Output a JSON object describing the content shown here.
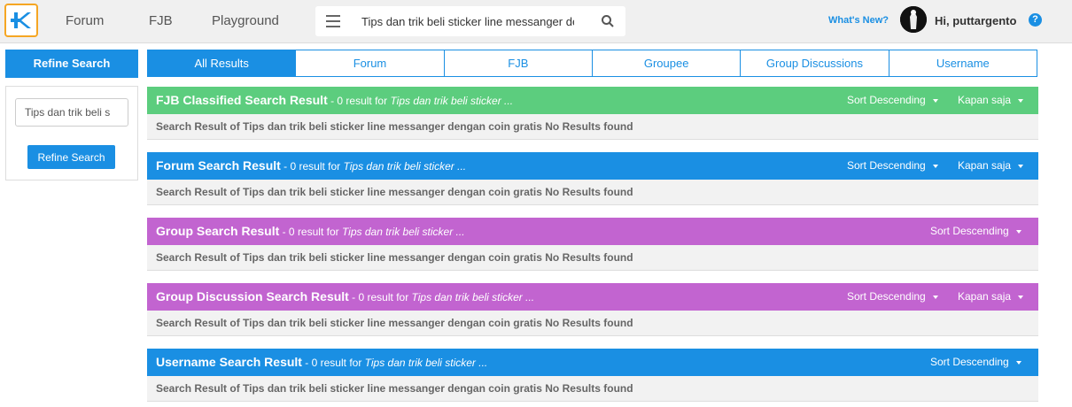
{
  "header": {
    "nav": [
      "Forum",
      "FJB",
      "Playground"
    ],
    "search_value": "Tips dan trik beli sticker line messanger den",
    "whats_new": "What's New?",
    "greeting": "Hi, puttargento",
    "help": "?"
  },
  "sidebar": {
    "title": "Refine Search",
    "input_value": "Tips dan trik beli s",
    "button": "Refine Search"
  },
  "tabs": [
    "All Results",
    "Forum",
    "FJB",
    "Groupee",
    "Group Discussions",
    "Username"
  ],
  "colors": {
    "blue": "#1a8fe3",
    "green": "#5ccd7e",
    "purple": "#c264d0",
    "logo_border": "#f5a623"
  },
  "results": [
    {
      "title": "FJB Classified Search Result",
      "count": " - 0 result for ",
      "query": "Tips dan trik beli sticker ...",
      "sort": "Sort Descending",
      "time": "Kapan saja",
      "body": "Search Result of Tips dan trik beli sticker line messanger dengan coin gratis No Results found"
    },
    {
      "title": "Forum Search Result",
      "count": " - 0 result for ",
      "query": "Tips dan trik beli sticker ...",
      "sort": "Sort Descending",
      "time": "Kapan saja",
      "body": "Search Result of Tips dan trik beli sticker line messanger dengan coin gratis No Results found"
    },
    {
      "title": "Group Search Result",
      "count": " - 0 result for ",
      "query": "Tips dan trik beli sticker ...",
      "sort": "Sort Descending",
      "body": "Search Result of Tips dan trik beli sticker line messanger dengan coin gratis No Results found"
    },
    {
      "title": "Group Discussion Search Result",
      "count": " - 0 result for ",
      "query": "Tips dan trik beli sticker ...",
      "sort": "Sort Descending",
      "time": "Kapan saja",
      "body": "Search Result of Tips dan trik beli sticker line messanger dengan coin gratis No Results found"
    },
    {
      "title": "Username Search Result",
      "count": " - 0 result for ",
      "query": "Tips dan trik beli sticker ...",
      "sort": "Sort Descending",
      "body": "Search Result of Tips dan trik beli sticker line messanger dengan coin gratis No Results found"
    }
  ]
}
